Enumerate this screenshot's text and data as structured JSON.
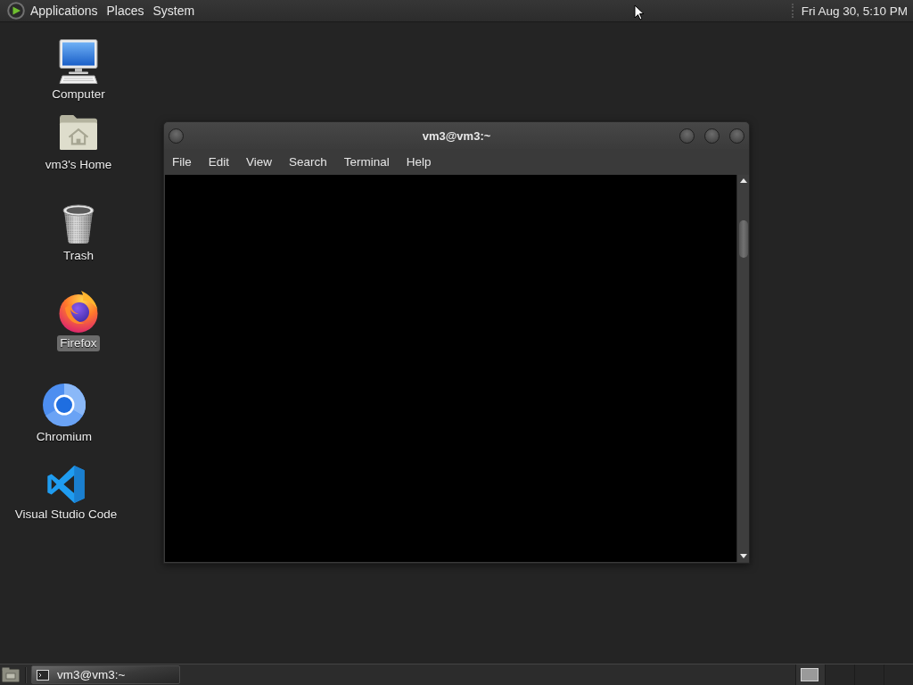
{
  "top_panel": {
    "menus": [
      "Applications",
      "Places",
      "System"
    ],
    "clock": "Fri Aug 30, 5:10 PM"
  },
  "desktop_icons": [
    {
      "label": "Computer",
      "kind": "computer",
      "selected": false
    },
    {
      "label": "vm3's Home",
      "kind": "home",
      "selected": false
    },
    {
      "label": "Trash",
      "kind": "trash",
      "selected": false
    },
    {
      "label": "Firefox",
      "kind": "firefox",
      "selected": true
    },
    {
      "label": "Chromium",
      "kind": "chromium",
      "selected": false
    },
    {
      "label": "Visual Studio Code",
      "kind": "vscode",
      "selected": false
    }
  ],
  "terminal_window": {
    "title": "vm3@vm3:~",
    "menus": [
      "File",
      "Edit",
      "View",
      "Search",
      "Terminal",
      "Help"
    ]
  },
  "bottom_panel": {
    "tasks": [
      {
        "label": "vm3@vm3:~"
      }
    ],
    "workspaces": [
      {
        "selected": true
      },
      {
        "selected": false
      },
      {
        "selected": false
      },
      {
        "selected": false
      }
    ]
  }
}
